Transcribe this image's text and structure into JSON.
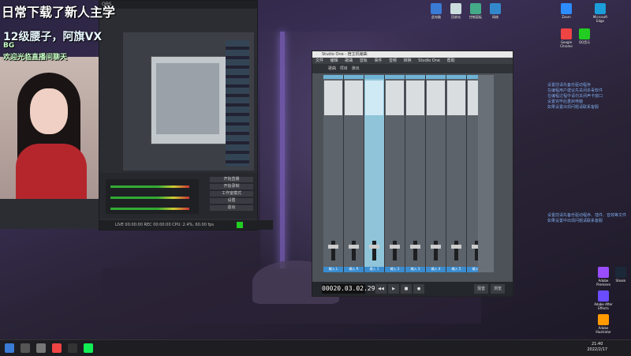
{
  "overlay": {
    "line1": "日常下载了新人主学",
    "line2": "12级腰子，阿旗VX",
    "line3": "BG",
    "line4": "欢迎光临直播间聊天"
  },
  "obs": {
    "controls": [
      "开始直播",
      "开始录制",
      "工作室模式",
      "设置",
      "退出"
    ],
    "status": "LIVE 00:00:00  REC 00:00:00  CPU: 2.4%, 60.00 fps"
  },
  "studio_one": {
    "title": "Studio One - 宿主机编曲",
    "menu": [
      "文件",
      "编辑",
      "歌曲",
      "音轨",
      "事件",
      "音频",
      "转换",
      "Studio One",
      "帮助"
    ],
    "time": "00020.03.02.29",
    "tabs": [
      "歌曲",
      "项目",
      "演出"
    ],
    "bottom_tabs": [
      "混音",
      "浏览"
    ],
    "channels": [
      "输入 L",
      "输入 R",
      "输入 1",
      "输入 2",
      "输入 3",
      "输入 4",
      "输入 5",
      "输入 6"
    ]
  },
  "desktop_notes": {
    "note1": [
      "设置前请先备份驱动程序",
      "在编程用户建议先关闭杀毒软件",
      "在编程过程中请勿关闭声卡窗口",
      "设置完毕后重启电脑",
      "如果设置出现问题请联系客服"
    ],
    "note2": [
      "设置前请先备份驱动程序、插件、音效等文件",
      "如果设置中出现问题请联系客服"
    ]
  },
  "desktop_icons": [
    {
      "label": "此电脑",
      "color": "#3a7bd5"
    },
    {
      "label": "回收站",
      "color": "#cdd"
    },
    {
      "label": "控制面板",
      "color": "#4a8"
    },
    {
      "label": "网络",
      "color": "#38c"
    },
    {
      "label": "Microsoft Edge",
      "color": "#1b9ed9"
    },
    {
      "label": "Google Chrome",
      "color": "#e44"
    },
    {
      "label": "Zoom",
      "color": "#2d8cff"
    },
    {
      "label": "QQ音乐",
      "color": "#2c2"
    },
    {
      "label": "Adobe Premiere",
      "color": "#9a4dff"
    },
    {
      "label": "Adobe After Effects",
      "color": "#6b4dff"
    },
    {
      "label": "Adobe Illustrator",
      "color": "#ff9a00"
    },
    {
      "label": "Steam",
      "color": "#1b2838"
    }
  ],
  "taskbar": {
    "time": "21:40",
    "date": "2022/2/17"
  }
}
